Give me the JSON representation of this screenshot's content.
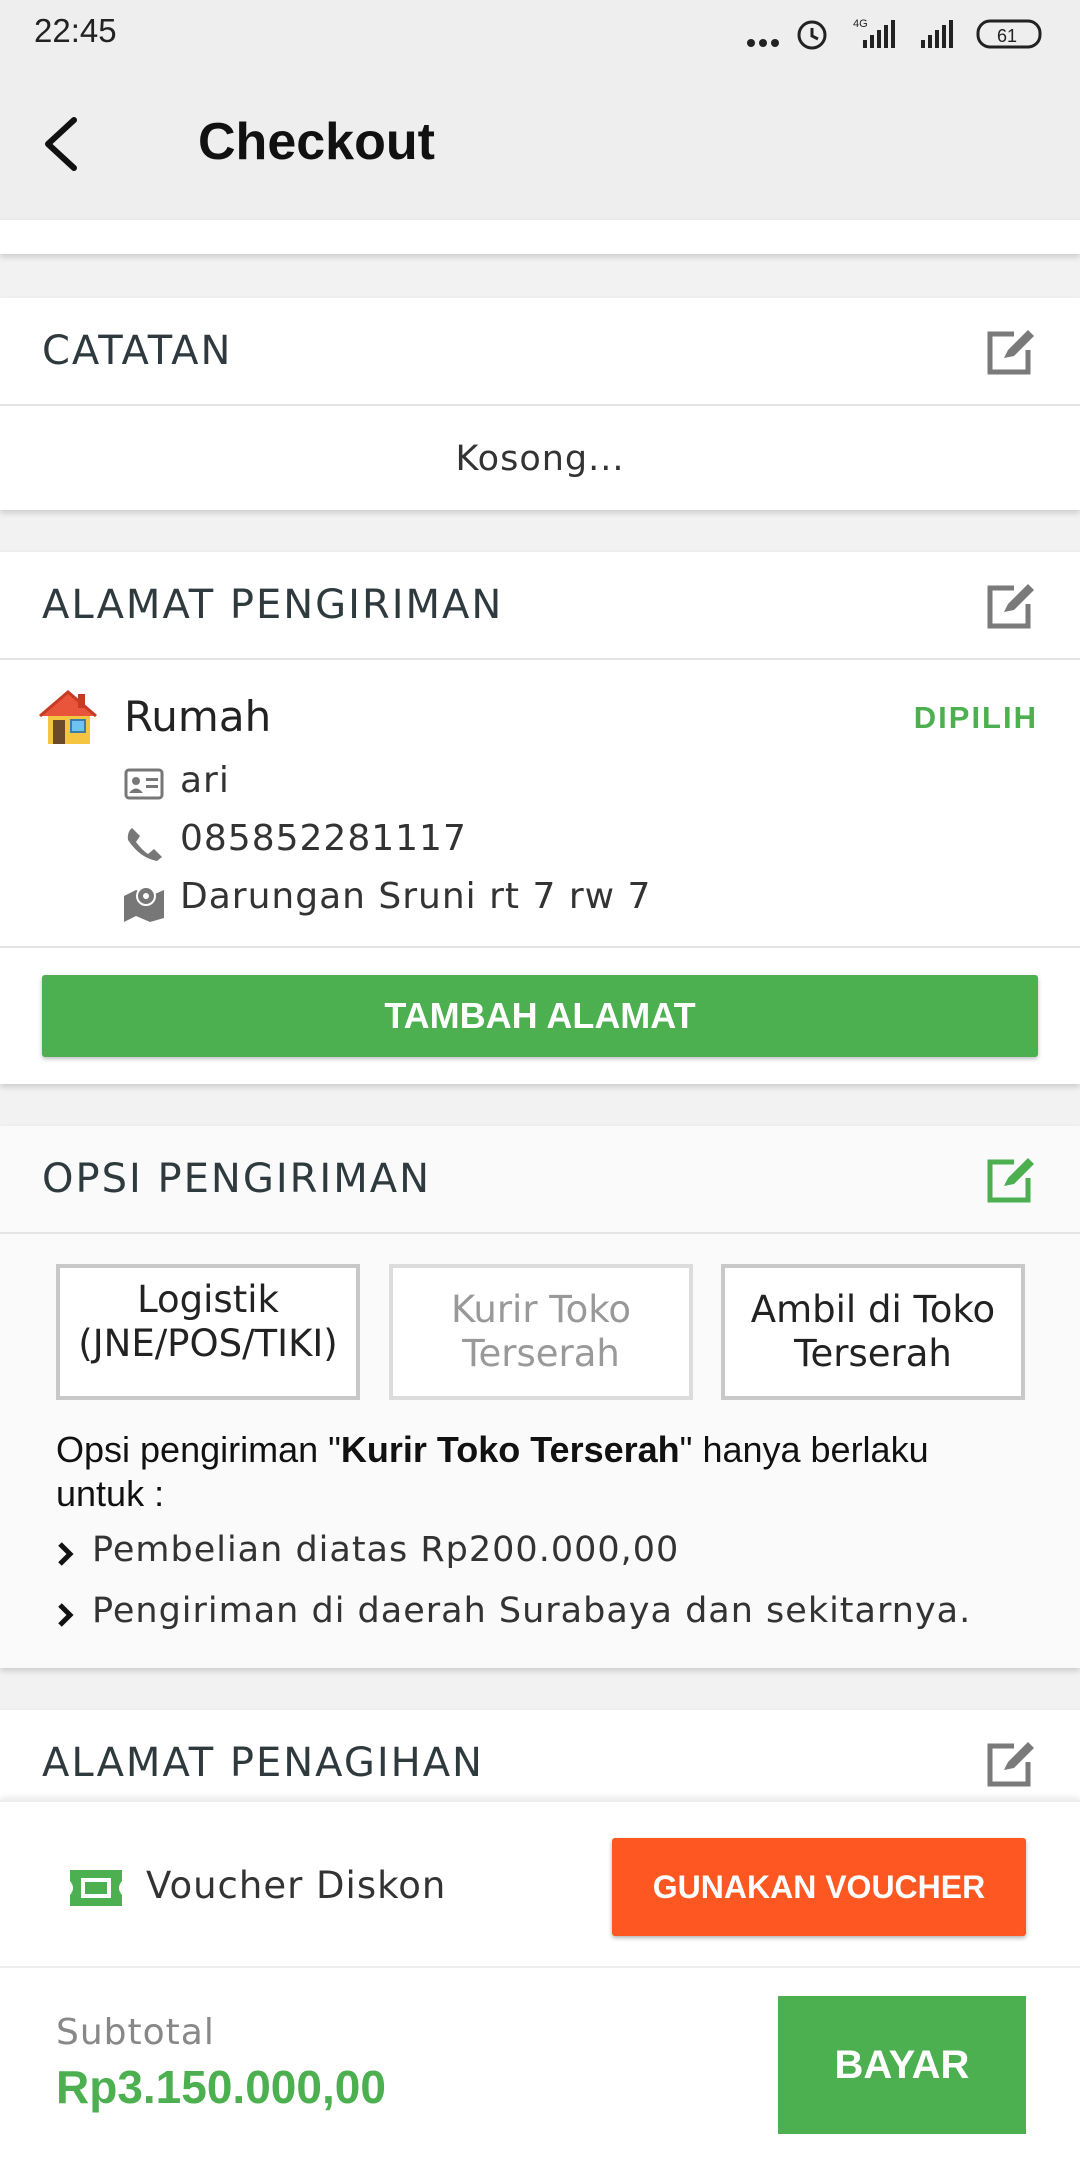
{
  "status_bar": {
    "time": "22:45",
    "network": "4G",
    "battery": "61"
  },
  "app_bar": {
    "title": "Checkout",
    "back_icon": "chevron-left-icon"
  },
  "notes": {
    "title": "CATATAN",
    "value": "Kosong..."
  },
  "shipping_address": {
    "title": "ALAMAT PENGIRIMAN",
    "address": {
      "label": "Rumah",
      "selected_badge": "DIPILIH",
      "name": "ari",
      "phone": "085852281117",
      "street": "Darungan Sruni rt 7 rw 7"
    },
    "add_button": "TAMBAH ALAMAT"
  },
  "shipping_options": {
    "title": "OPSI PENGIRIMAN",
    "options": [
      {
        "label": "Logistik (JNE/POS/TIKI)"
      },
      {
        "label": "Kurir Toko Terserah"
      },
      {
        "label": "Ambil di Toko Terserah"
      }
    ],
    "info_prefix": "Opsi pengiriman \"",
    "info_bold": "Kurir Toko Terserah",
    "info_suffix": "\" hanya berlaku untuk :",
    "conditions": [
      "Pembelian diatas Rp200.000,00",
      "Pengiriman di daerah Surabaya dan sekitarnya."
    ]
  },
  "billing_address": {
    "title": "ALAMAT PENAGIHAN"
  },
  "voucher": {
    "label": "Voucher Diskon",
    "button": "GUNAKAN VOUCHER"
  },
  "footer": {
    "subtotal_label": "Subtotal",
    "subtotal_value": "Rp3.150.000,00",
    "pay_button": "BAYAR"
  },
  "colors": {
    "accent_green": "#4caf50",
    "accent_orange": "#ff5722",
    "text_dark": "#2f3a3f"
  }
}
